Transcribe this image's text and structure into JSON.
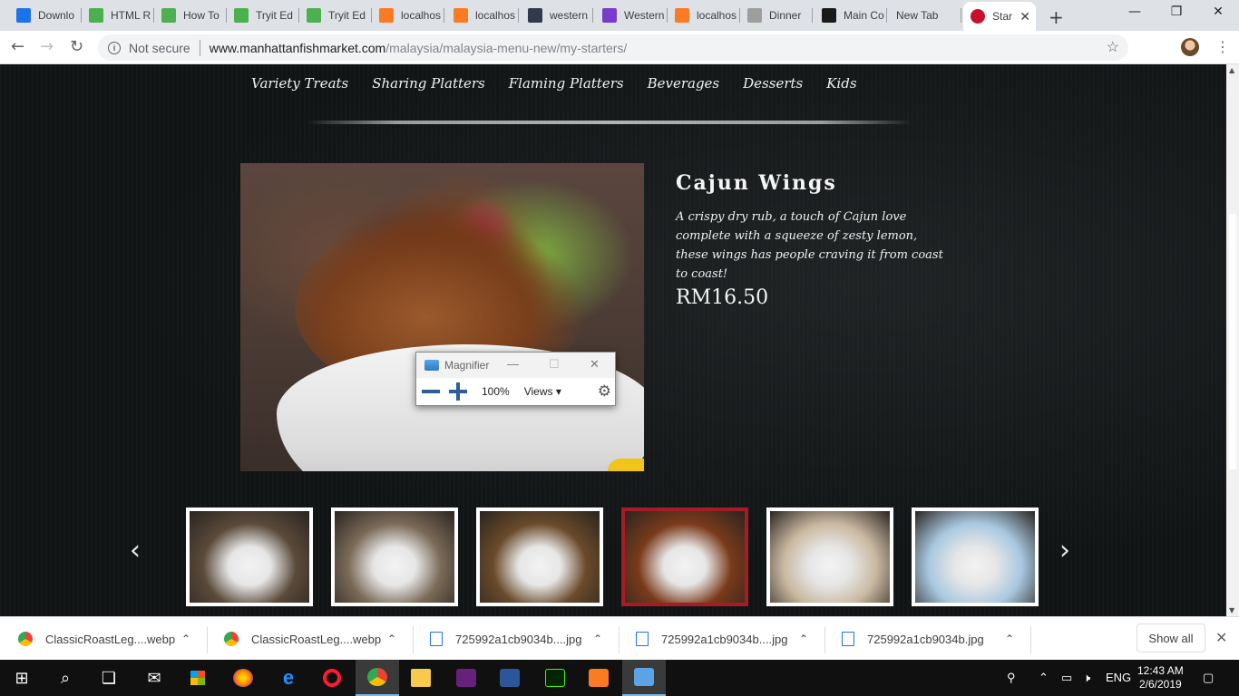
{
  "browser": {
    "tabs": [
      {
        "label": "Downlo",
        "icon": "download-icon",
        "color": "#1a73e8"
      },
      {
        "label": "HTML R",
        "icon": "w3schools-icon",
        "color": "#4caf50"
      },
      {
        "label": "How To",
        "icon": "w3schools-icon",
        "color": "#4caf50"
      },
      {
        "label": "Tryit Ed",
        "icon": "w3schools-icon",
        "color": "#4caf50"
      },
      {
        "label": "Tryit Ed",
        "icon": "w3schools-icon",
        "color": "#4caf50"
      },
      {
        "label": "localhos",
        "icon": "xampp-icon",
        "color": "#fb7a24"
      },
      {
        "label": "localhos",
        "icon": "xampp-icon",
        "color": "#fb7a24"
      },
      {
        "label": "western",
        "icon": "site-icon",
        "color": "#2f3b4c"
      },
      {
        "label": "Western",
        "icon": "gemini-icon",
        "color": "#7a3cc8"
      },
      {
        "label": "localhos",
        "icon": "xampp-icon",
        "color": "#fb7a24"
      },
      {
        "label": "Dinner",
        "icon": "page-icon",
        "color": "#9e9e9e"
      },
      {
        "label": "Main Co",
        "icon": "scribd-icon",
        "color": "#1a1a1a"
      },
      {
        "label": "New Tab",
        "icon": "",
        "color": ""
      }
    ],
    "active_tab": {
      "label": "Star",
      "icon": "manhattan-fish-market-icon",
      "color": "#c8102e"
    },
    "url_security": "Not secure",
    "url_domain": "www.manhattanfishmarket.com",
    "url_path": "/malaysia/malaysia-menu-new/my-starters/"
  },
  "page": {
    "menu": [
      "Variety Treats",
      "Sharing Platters",
      "Flaming Platters",
      "Beverages",
      "Desserts",
      "Kids"
    ],
    "item_title": "Cajun Wings",
    "item_description": "A crispy dry rub, a touch of Cajun love complete with a squeeze of zesty lemon, these wings has people craving it from coast to coast!",
    "item_price": "RM16.50",
    "thumbnails": [
      {
        "name": "starter-1",
        "color": "#5a4a3a",
        "selected": false
      },
      {
        "name": "starter-2",
        "color": "#7a6a58",
        "selected": false
      },
      {
        "name": "starter-3",
        "color": "#6a4a2a",
        "selected": false
      },
      {
        "name": "starter-4",
        "color": "#7a3a1a",
        "selected": true
      },
      {
        "name": "starter-5",
        "color": "#c9b8a0",
        "selected": false
      },
      {
        "name": "starter-6",
        "color": "#a8c8e0",
        "selected": false
      }
    ],
    "selected_border_color": "#a51c24"
  },
  "magnifier": {
    "title": "Magnifier",
    "zoom": "100%",
    "views_label": "Views"
  },
  "downloads": {
    "items": [
      {
        "name": "ClassicRoastLeg....webp",
        "type": "chrome"
      },
      {
        "name": "ClassicRoastLeg....webp",
        "type": "chrome"
      },
      {
        "name": "725992a1cb9034b....jpg",
        "type": "img"
      },
      {
        "name": "725992a1cb9034b....jpg",
        "type": "img"
      },
      {
        "name": "725992a1cb9034b.jpg",
        "type": "img"
      }
    ],
    "show_all_label": "Show all"
  },
  "taskbar": {
    "language": "ENG",
    "time": "12:43 AM",
    "date": "2/6/2019"
  }
}
